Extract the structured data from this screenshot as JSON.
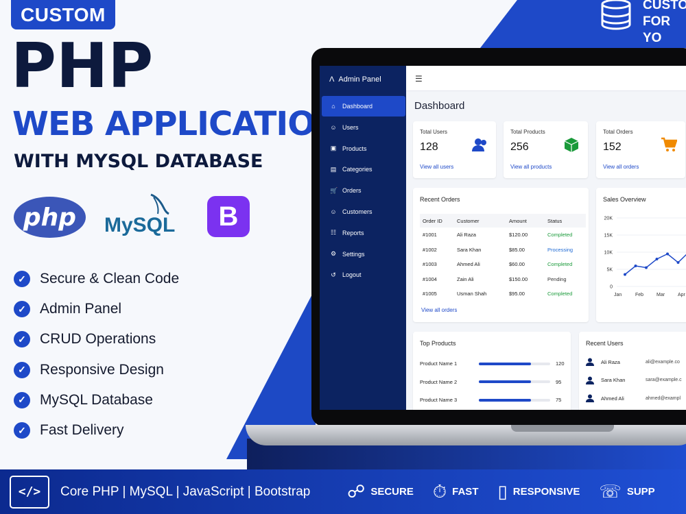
{
  "hero": {
    "badge": "CUSTOM",
    "title_line1": "PHP",
    "title_line2": "WEB APPLICATION",
    "title_line3": "WITH MYSQL DATABASE",
    "top_right_line1": "CUSTO",
    "top_right_line2": "FOR YO"
  },
  "logos": {
    "php": "php",
    "bootstrap": "B",
    "mysql": "MySQL"
  },
  "features": [
    "Secure & Clean Code",
    "Admin Panel",
    "CRUD Operations",
    "Responsive Design",
    "MySQL Database",
    "Fast Delivery"
  ],
  "bottom_bar": {
    "tech_stack": "Core PHP | MySQL | JavaScript | Bootstrap",
    "items": [
      "SECURE",
      "FAST",
      "RESPONSIVE",
      "SUPP"
    ]
  },
  "admin": {
    "brand": "Admin Panel",
    "nav": [
      "Dashboard",
      "Users",
      "Products",
      "Categories",
      "Orders",
      "Customers",
      "Reports",
      "Settings",
      "Logout"
    ],
    "page_title": "Dashboard",
    "stats": [
      {
        "label": "Total Users",
        "value": "128",
        "link": "View all users",
        "icon": "users-icon"
      },
      {
        "label": "Total Products",
        "value": "256",
        "link": "View all products",
        "icon": "box-icon"
      },
      {
        "label": "Total Orders",
        "value": "152",
        "link": "View all orders",
        "icon": "cart-icon"
      }
    ],
    "recent_orders": {
      "title": "Recent Orders",
      "columns": [
        "Order ID",
        "Customer",
        "Amount",
        "Status"
      ],
      "rows": [
        [
          "#1001",
          "Ali Raza",
          "$120.00",
          "Completed"
        ],
        [
          "#1002",
          "Sara Khan",
          "$85.00",
          "Processing"
        ],
        [
          "#1003",
          "Ahmed Ali",
          "$60.00",
          "Completed"
        ],
        [
          "#1004",
          "Zain Ali",
          "$150.00",
          "Pending"
        ],
        [
          "#1005",
          "Usman Shah",
          "$95.00",
          "Completed"
        ]
      ],
      "link": "View all orders"
    },
    "top_products": {
      "title": "Top Products",
      "items": [
        {
          "name": "Product Name 1",
          "value": "120",
          "fill": 0.73
        },
        {
          "name": "Product Name 2",
          "value": "95",
          "fill": 0.73
        },
        {
          "name": "Product Name 3",
          "value": "75",
          "fill": 0.73
        }
      ]
    },
    "recent_users": {
      "title": "Recent Users",
      "items": [
        {
          "name": "Ali Raza",
          "email": "ali@example.co"
        },
        {
          "name": "Sara Khan",
          "email": "sara@example.c"
        },
        {
          "name": "Ahmed Ali",
          "email": "ahmed@exampl"
        }
      ]
    },
    "colors": {
      "accent": "#1e49c8",
      "sidebar": "#0c2361",
      "completed": "#1a9a3a",
      "processing": "#1f6ad4"
    }
  },
  "chart_data": {
    "type": "line",
    "title": "Sales Overview",
    "categories": [
      "Jan",
      "Feb",
      "Mar",
      "Apr"
    ],
    "x": [
      0,
      0.5,
      1,
      1.5,
      2,
      2.5,
      3,
      3.5,
      3.8
    ],
    "y": [
      3.5,
      6,
      5.5,
      8,
      9.5,
      7,
      10,
      8.5,
      10
    ],
    "yticks": [
      "0",
      "5K",
      "10K",
      "15K",
      "20K"
    ],
    "ylim": [
      0,
      20000
    ],
    "grid": true
  }
}
